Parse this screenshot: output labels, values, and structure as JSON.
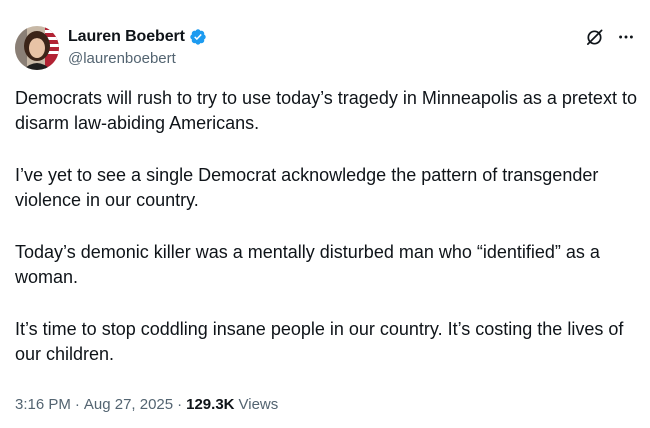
{
  "author": {
    "display_name": "Lauren Boebert",
    "handle": "@laurenboebert",
    "verified_color": "#1d9bf0"
  },
  "icons": {
    "verified": "verified-badge-icon",
    "grok": "grok-icon",
    "more": "more-options-icon"
  },
  "tweet": {
    "paragraphs": [
      "Democrats will rush to try to use today’s tragedy in Minneapolis as a pretext to disarm law-abiding Americans.",
      "I’ve yet to see a single Democrat acknowledge the pattern of transgender violence in our country.",
      "Today’s demonic killer was a mentally disturbed man who “identified” as a woman.",
      "It’s time to stop coddling insane people in our country. It’s costing the lives of our children."
    ],
    "time": "3:16 PM",
    "separator": "·",
    "date": "Aug 27, 2025",
    "views_count": "129.3K",
    "views_label": "Views"
  }
}
